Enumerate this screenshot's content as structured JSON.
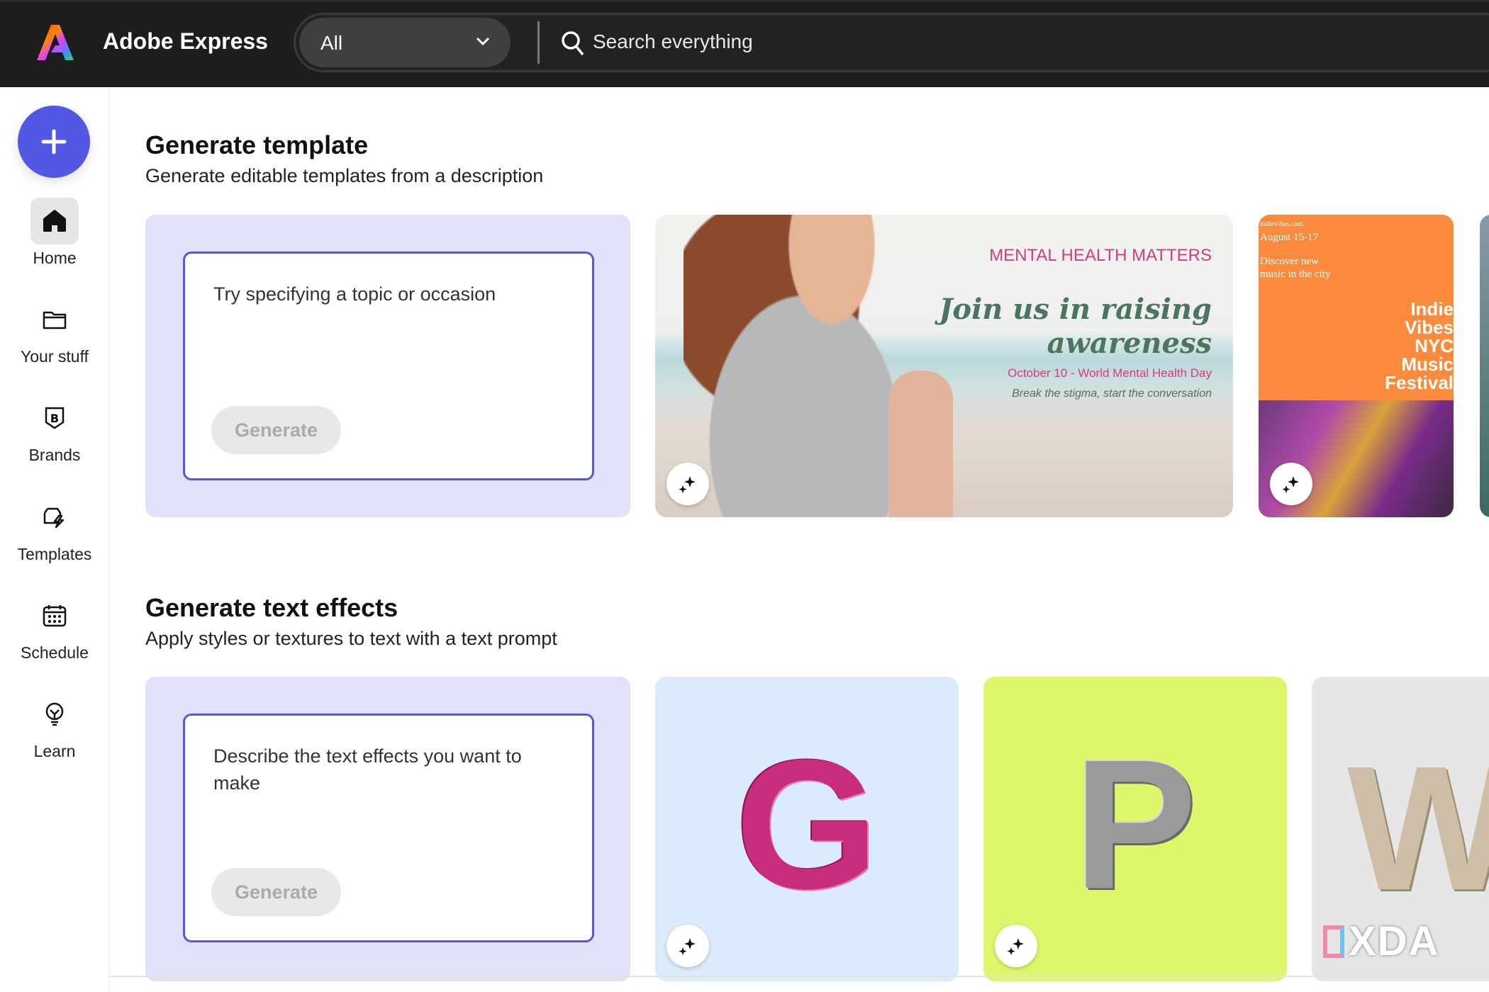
{
  "header": {
    "app_title": "Adobe Express",
    "scope": "All",
    "search_placeholder": "Search everything"
  },
  "sidebar": {
    "items": [
      {
        "label": "Home",
        "icon": "home-icon",
        "active": true
      },
      {
        "label": "Your stuff",
        "icon": "folder-icon"
      },
      {
        "label": "Brands",
        "icon": "brand-icon"
      },
      {
        "label": "Templates",
        "icon": "templates-icon"
      },
      {
        "label": "Schedule",
        "icon": "calendar-icon"
      },
      {
        "label": "Learn",
        "icon": "lightbulb-icon"
      }
    ]
  },
  "sections": [
    {
      "title": "Generate template",
      "subtitle": "Generate editable templates from a description",
      "placeholder": "Try specifying a topic or occasion",
      "button": "Generate",
      "thumbs": [
        {
          "heading": "MENTAL HEALTH MATTERS",
          "script1": "Join us in raising",
          "script2": "awareness",
          "line1": "October 10 - World Mental Health Day",
          "line2": "Break the stigma, start the conversation"
        },
        {
          "site": "indievibes.com",
          "date": "August 15-17",
          "tag1": "Discover new",
          "tag2": "music in the city",
          "title": [
            "Indie",
            "Vibes",
            "NYC",
            "Music",
            "Festival"
          ]
        }
      ]
    },
    {
      "title": "Generate text effects",
      "subtitle": "Apply styles or textures to text with a text prompt",
      "placeholder": "Describe the text effects you want to make",
      "button": "Generate",
      "thumbs": [
        {
          "letter": "G",
          "bg": "#dcebfb"
        },
        {
          "letter": "P",
          "bg": "#dcf76a"
        },
        {
          "letter": "W",
          "bg": "#e6e6e6"
        }
      ]
    }
  ],
  "watermark": "XDA",
  "colors": {
    "accent": "#5258e4",
    "topbar": "#1d1d1d",
    "prompt_card": "#e1e1fb",
    "orange": "#fb8a3c"
  }
}
